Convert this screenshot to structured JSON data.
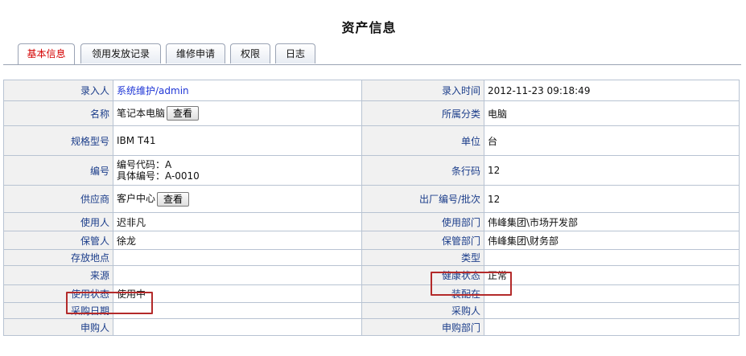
{
  "page": {
    "title": "资产信息"
  },
  "tabs": [
    {
      "label": "基本信息",
      "active": true
    },
    {
      "label": "领用发放记录",
      "active": false
    },
    {
      "label": "维修申请",
      "active": false
    },
    {
      "label": "权限",
      "active": false
    },
    {
      "label": "日志",
      "active": false
    }
  ],
  "buttons": {
    "view": "查看"
  },
  "rows": [
    {
      "l1": "录入人",
      "v1": "系统维护/admin",
      "l2": "录入时间",
      "v2": "2012-11-23 09:18:49"
    },
    {
      "l1": "名称",
      "v1": "笔记本电脑",
      "l2": "所属分类",
      "v2": "电脑"
    },
    {
      "l1": "规格型号",
      "v1": "IBM T41",
      "l2": "单位",
      "v2": "台"
    },
    {
      "l1": "编号",
      "v1a": "编号代码：A",
      "v1b": "具体编号：A-0010",
      "l2": "条行码",
      "v2": "12"
    },
    {
      "l1": "供应商",
      "v1": "客户中心",
      "l2": "出厂编号/批次",
      "v2": "12"
    },
    {
      "l1": "使用人",
      "v1": "迟非凡",
      "l2": "使用部门",
      "v2": "伟峰集团\\市场开发部"
    },
    {
      "l1": "保管人",
      "v1": "徐龙",
      "l2": "保管部门",
      "v2": "伟峰集团\\财务部"
    },
    {
      "l1": "存放地点",
      "v1": "",
      "l2": "类型",
      "v2": ""
    },
    {
      "l1": "来源",
      "v1": "",
      "l2": "健康状态",
      "v2": "正常"
    },
    {
      "l1": "使用状态",
      "v1": "使用中",
      "l2": "装配在",
      "v2": ""
    },
    {
      "l1": "采购日期",
      "v1": "",
      "l2": "采购人",
      "v2": ""
    },
    {
      "l1": "申购人",
      "v1": "",
      "l2": "申购部门",
      "v2": ""
    }
  ],
  "colors": {
    "highlight": "#b32a2a",
    "label_text": "#1b3d8a",
    "active_tab": "#d40000",
    "link": "#1f36d6"
  }
}
